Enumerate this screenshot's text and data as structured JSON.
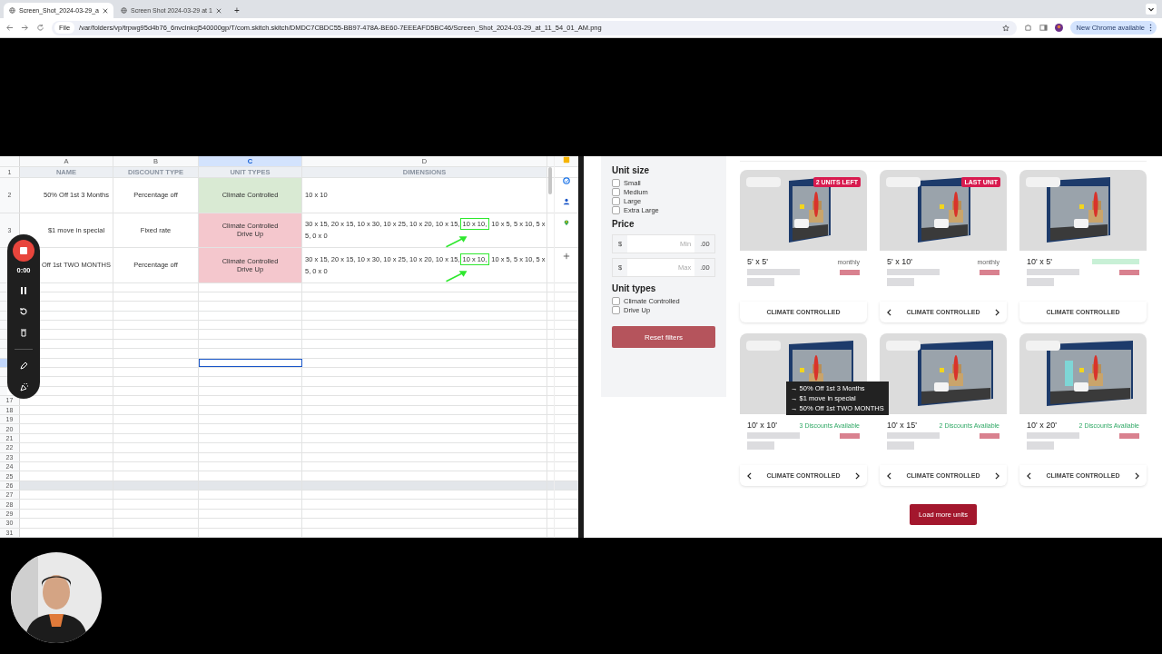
{
  "browser": {
    "tabs": [
      {
        "title": "Screen_Shot_2024-03-29_a",
        "selected": true
      },
      {
        "title": "Screen Shot 2024-03-29 at 1",
        "selected": false
      }
    ],
    "new_tab": "+",
    "address": {
      "chip": "File",
      "url": "/var/folders/vp/trpwg95d4b76_6nvclnkcj540000gp/T/com.skitch.skitch/DMDC7CBDC55-BB97-478A-BE60-7EEEAFD5BC46/Screen_Shot_2024-03-29_at_11_54_01_AM.png"
    },
    "update_button": "New Chrome available"
  },
  "sheet": {
    "columns": [
      {
        "letter": "A",
        "heading": "NAME",
        "selected": false
      },
      {
        "letter": "B",
        "heading": "DISCOUNT TYPE",
        "selected": false
      },
      {
        "letter": "C",
        "heading": "UNIT TYPES",
        "selected": true
      },
      {
        "letter": "D",
        "heading": "DIMENSIONS",
        "selected": false
      }
    ],
    "header_row_number": "1",
    "rows": [
      {
        "number": "2",
        "name": "50% Off 1st 3 Months",
        "discount_type": "Percentage off",
        "unit_types": "Climate Controlled",
        "color": "#d9ead3",
        "dimensions": {
          "before": "10 x 10"
        }
      },
      {
        "number": "3",
        "name": "$1 move in special",
        "discount_type": "Fixed rate",
        "unit_types": "Climate Controlled\nDrive Up",
        "color": "#f4c7cd",
        "dimensions": {
          "before": "30 x 15, 20 x 15, 10 x 30, 10 x 25, 10 x 20, 10 x 15,",
          "marked": "10 x 10,",
          "after": "10 x 5, 5 x 10, 5 x 5, 0 x 0"
        }
      },
      {
        "name": "Off 1st TWO MONTHS",
        "discount_type": "Percentage off",
        "unit_types": "Climate Controlled\nDrive Up",
        "color": "#f4c7cd",
        "dimensions": {
          "before": "30 x 15, 20 x 15, 10 x 30, 10 x 25, 10 x 20, 10 x 15,",
          "marked": "10 x 10,",
          "after": "10 x 5, 5 x 10, 5 x 5, 0 x 0"
        }
      }
    ],
    "empty_rows": [
      {
        "selected": false,
        "shaded": false
      },
      {
        "selected": false,
        "shaded": false
      },
      {
        "selected": false,
        "shaded": false
      },
      {
        "selected": false,
        "shaded": false
      },
      {
        "selected": false,
        "shaded": false
      },
      {
        "selected": false,
        "shaded": false
      },
      {
        "selected": false,
        "shaded": false
      },
      {
        "selected": false,
        "shaded": false
      },
      {
        "selected": true,
        "shaded": false
      },
      {
        "selected": false,
        "shaded": false
      },
      {
        "selected": false,
        "shaded": false
      },
      {
        "selected": false,
        "shaded": false
      },
      {
        "number": "17",
        "selected": false,
        "shaded": false
      },
      {
        "number": "18",
        "selected": false,
        "shaded": false
      },
      {
        "number": "19",
        "selected": false,
        "shaded": false
      },
      {
        "number": "20",
        "selected": false,
        "shaded": false
      },
      {
        "number": "21",
        "selected": false,
        "shaded": false
      },
      {
        "number": "22",
        "selected": false,
        "shaded": false
      },
      {
        "number": "23",
        "selected": false,
        "shaded": false
      },
      {
        "number": "24",
        "selected": false,
        "shaded": false
      },
      {
        "number": "25",
        "selected": false,
        "shaded": false
      },
      {
        "number": "26",
        "selected": false,
        "shaded": true
      },
      {
        "number": "27",
        "selected": false,
        "shaded": false
      },
      {
        "number": "28",
        "selected": false,
        "shaded": false
      },
      {
        "number": "29",
        "selected": false,
        "shaded": false
      },
      {
        "number": "30",
        "selected": false,
        "shaded": false
      },
      {
        "number": "31",
        "selected": false,
        "shaded": false
      }
    ]
  },
  "recorder": {
    "time": "0:00"
  },
  "page": {
    "filters": [
      {
        "title": "Unit size",
        "kind": "checkboxes",
        "options": [
          {
            "label": "Small",
            "checked": false
          },
          {
            "label": "Medium",
            "checked": false
          },
          {
            "label": "Large",
            "checked": false
          },
          {
            "label": "Extra Large",
            "checked": false
          }
        ]
      },
      {
        "title": "Price",
        "kind": "range",
        "fields": [
          {
            "prefix": "$",
            "placeholder": "Min",
            "suffix": ".00"
          },
          {
            "prefix": "$",
            "placeholder": "Max",
            "suffix": ".00"
          }
        ]
      },
      {
        "title": "Unit types",
        "kind": "checkboxes",
        "options": [
          {
            "label": "Climate Controlled",
            "checked": false
          },
          {
            "label": "Drive Up",
            "checked": false
          }
        ]
      }
    ],
    "reset_button": "Reset filters",
    "units": [
      {
        "size": "5' x 5'",
        "kind": "monthly",
        "rate_label": "monthly",
        "badge": "2 UNITS LEFT",
        "unit_type": "CLIMATE CONTROLLED",
        "arrows": false
      },
      {
        "size": "5' x 10'",
        "kind": "monthly",
        "rate_label": "monthly",
        "badge": "LAST UNIT",
        "unit_type": "CLIMATE CONTROLLED",
        "arrows": true
      },
      {
        "size": "10' x 5'",
        "kind": "promo",
        "unit_type": "CLIMATE CONTROLLED",
        "arrows": false
      },
      {
        "size": "10' x 10'",
        "kind": "discounts",
        "rate_label": "3 Discounts Available",
        "unit_type": "CLIMATE CONTROLLED",
        "arrows": true,
        "tooltip": [
          "→ 50% Off 1st 3 Months",
          "→ $1 move in special",
          "→ 50% Off 1st TWO MONTHS"
        ]
      },
      {
        "size": "10' x 15'",
        "kind": "discounts",
        "rate_label": "2 Discounts Available",
        "unit_type": "CLIMATE CONTROLLED",
        "arrows": true
      },
      {
        "size": "10' x 20'",
        "kind": "discounts",
        "rate_label": "2 Discounts Available",
        "unit_type": "CLIMATE CONTROLLED",
        "arrows": true
      }
    ],
    "load_more_button": "Load more units"
  }
}
